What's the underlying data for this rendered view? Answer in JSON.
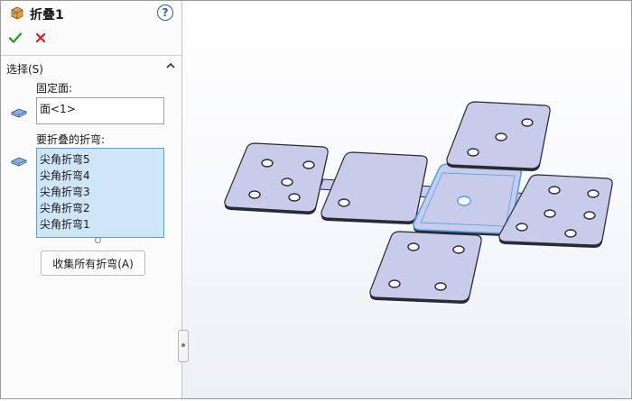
{
  "panel": {
    "title": "折叠1",
    "help_glyph": "?",
    "group_title": "选择(S)",
    "fixed_face_label": "固定面:",
    "fixed_face_value": "面<1>",
    "bends_label": "要折叠的折弯:",
    "bends": [
      "尖角折弯5",
      "尖角折弯4",
      "尖角折弯3",
      "尖角折弯2",
      "尖角折弯1"
    ],
    "collect_button_label": "收集所有折弯(A)"
  },
  "colors": {
    "plate_fill": "#c9cbea",
    "plate_edge": "#2a2a33",
    "selected_face_edge": "#4da3e8",
    "list_fill": "#cfe5f8",
    "ok_green": "#2e9c2e",
    "cancel_red": "#d42020"
  },
  "icons": [
    "sheetmetal-part-icon",
    "help-icon",
    "ok-icon",
    "cancel-icon",
    "collapse-icon",
    "face-icon"
  ]
}
